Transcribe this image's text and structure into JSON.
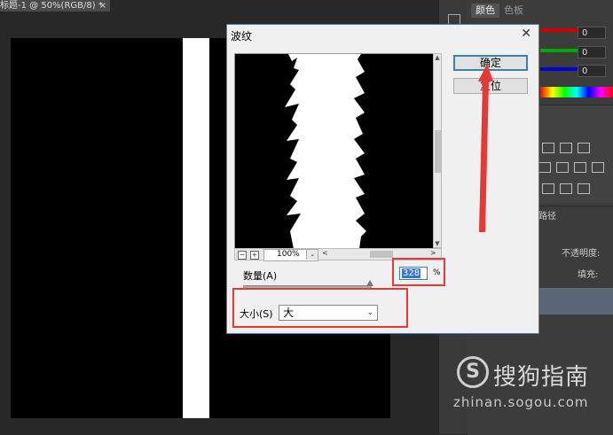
{
  "document": {
    "tab_title": "标题-1 @ 50%(RGB/8) *",
    "tab_close": "×"
  },
  "dialog": {
    "title": "波纹",
    "close_glyph": "✕",
    "ok_label": "确定",
    "reset_label": "复位",
    "zoom": {
      "minus": "−",
      "plus": "+",
      "value": "100%",
      "dropdown": "⌄",
      "scroll_left": "<",
      "scroll_right": ">"
    },
    "amount": {
      "label": "数量(A)",
      "value": "328",
      "unit": "%"
    },
    "size": {
      "label": "大小(S)",
      "value": "大",
      "dropdown": "⌄"
    }
  },
  "right_panel": {
    "tabs": [
      "颜色",
      "色板"
    ],
    "slider_values": [
      "0",
      "0",
      "0"
    ],
    "slider_colors": [
      "#cc0000",
      "#00aa00",
      "#0000cc"
    ],
    "layers_tab": "路径",
    "opacity_label": "不透明度:",
    "fill_label": "填充:"
  },
  "watermark": {
    "logo": "S",
    "text": "搜狗指南",
    "url": "zhinan.sogou.com"
  },
  "annotation_color": "#e53935"
}
